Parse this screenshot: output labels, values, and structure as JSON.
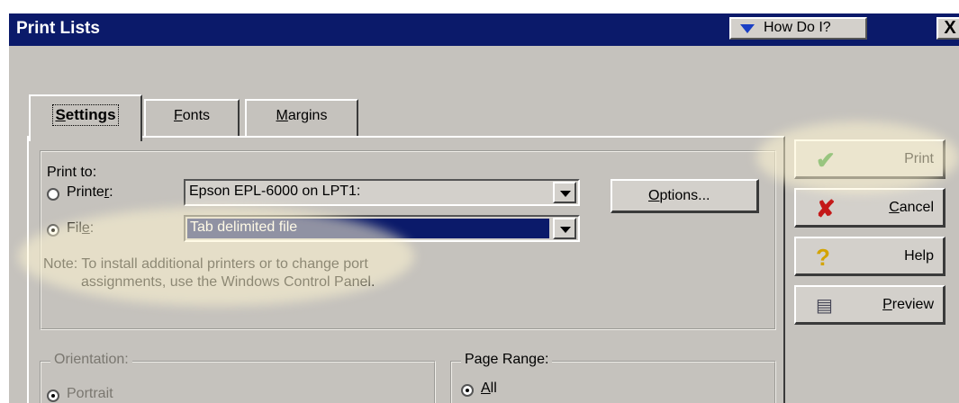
{
  "window": {
    "title": "Print Lists",
    "howdoi_label": "How Do I?",
    "close_label": "X"
  },
  "tabs": [
    {
      "label": "Settings",
      "active": true
    },
    {
      "label": "Fonts",
      "active": false
    },
    {
      "label": "Margins",
      "active": false
    }
  ],
  "print_to": {
    "label": "Print to:",
    "printer_label": "Printer:",
    "printer_value": "Epson EPL-6000 on LPT1:",
    "file_label": "File:",
    "file_value": "Tab delimited file",
    "selected": "file",
    "options_label": "Options..."
  },
  "note": {
    "line1": "Note: To install additional printers or to change port",
    "line2": "assignments, use the Windows Control Panel."
  },
  "orientation": {
    "label": "Orientation:",
    "portrait_label": "Portrait",
    "selected": "portrait"
  },
  "page_range": {
    "label": "Page Range:",
    "all_label": "All",
    "selected": "all"
  },
  "side_buttons": {
    "print_label": "Print",
    "cancel_label": "Cancel",
    "help_label": "Help",
    "preview_label": "Preview"
  },
  "colors": {
    "titlebar": "#0b1a6a",
    "face": "#c5c2bd",
    "highlight": "#fff5d2"
  }
}
